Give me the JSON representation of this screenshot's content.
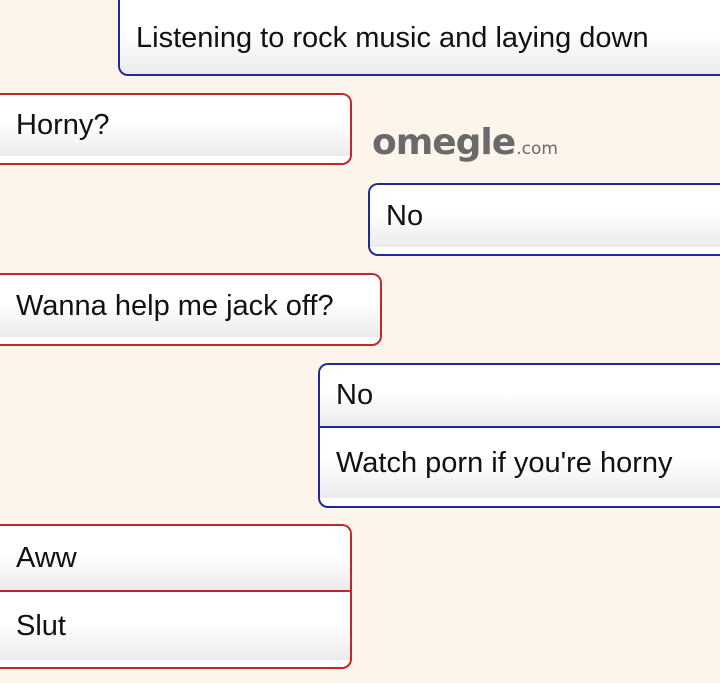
{
  "logo": {
    "main": "omegle",
    "suffix": ".com"
  },
  "messages": [
    {
      "sender": "you",
      "lines": [
        "Listening to rock music and laying down"
      ]
    },
    {
      "sender": "stranger",
      "lines": [
        "Horny?"
      ]
    },
    {
      "sender": "you",
      "lines": [
        "No"
      ]
    },
    {
      "sender": "stranger",
      "lines": [
        "Wanna help me jack off?"
      ]
    },
    {
      "sender": "you",
      "lines": [
        "No",
        "Watch porn if you're horny"
      ]
    },
    {
      "sender": "stranger",
      "lines": [
        "Aww",
        "Slut"
      ]
    }
  ],
  "colors": {
    "background": "#fdf5ec",
    "you_border": "#1e2a9a",
    "stranger_border": "#c0282a"
  }
}
